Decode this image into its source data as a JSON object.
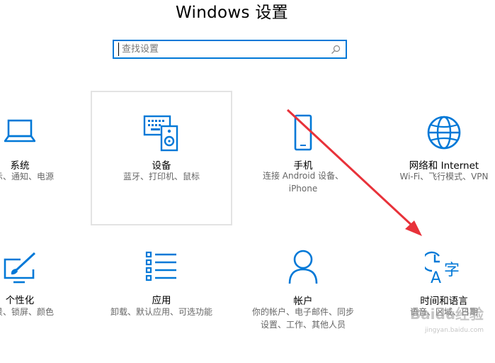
{
  "header": {
    "title": "Windows 设置"
  },
  "search": {
    "placeholder": "查找设置",
    "icon": "search-icon"
  },
  "tiles": [
    {
      "name": "系统",
      "desc": [
        "显示、通知、电源"
      ],
      "icon": "laptop-icon"
    },
    {
      "name": "设备",
      "desc": [
        "蓝牙、打印机、鼠标"
      ],
      "icon": "keyboard-speaker-icon"
    },
    {
      "name": "手机",
      "desc": [
        "连接 Android 设备、",
        "iPhone"
      ],
      "icon": "phone-icon"
    },
    {
      "name": "网络和 Internet",
      "desc": [
        "Wi-Fi、飞行模式、VPN"
      ],
      "icon": "globe-icon"
    },
    {
      "name": "个性化",
      "desc": [
        "背景、锁屏、颜色"
      ],
      "icon": "brush-icon"
    },
    {
      "name": "应用",
      "desc": [
        "卸载、默认应用、可选功能"
      ],
      "icon": "list-icon"
    },
    {
      "name": "帐户",
      "desc": [
        "你的帐户、电子邮件、同步",
        "设置、工作、其他人员"
      ],
      "icon": "person-icon"
    },
    {
      "name": "时间和语言",
      "desc": [
        "语音、区域、日期"
      ],
      "icon": "clock-language-icon"
    }
  ],
  "watermark": {
    "text": "Baidu经验",
    "sub": "jingyan.baidu.com"
  },
  "colors": {
    "accent": "#0078d7",
    "arrow": "#e8323a"
  }
}
